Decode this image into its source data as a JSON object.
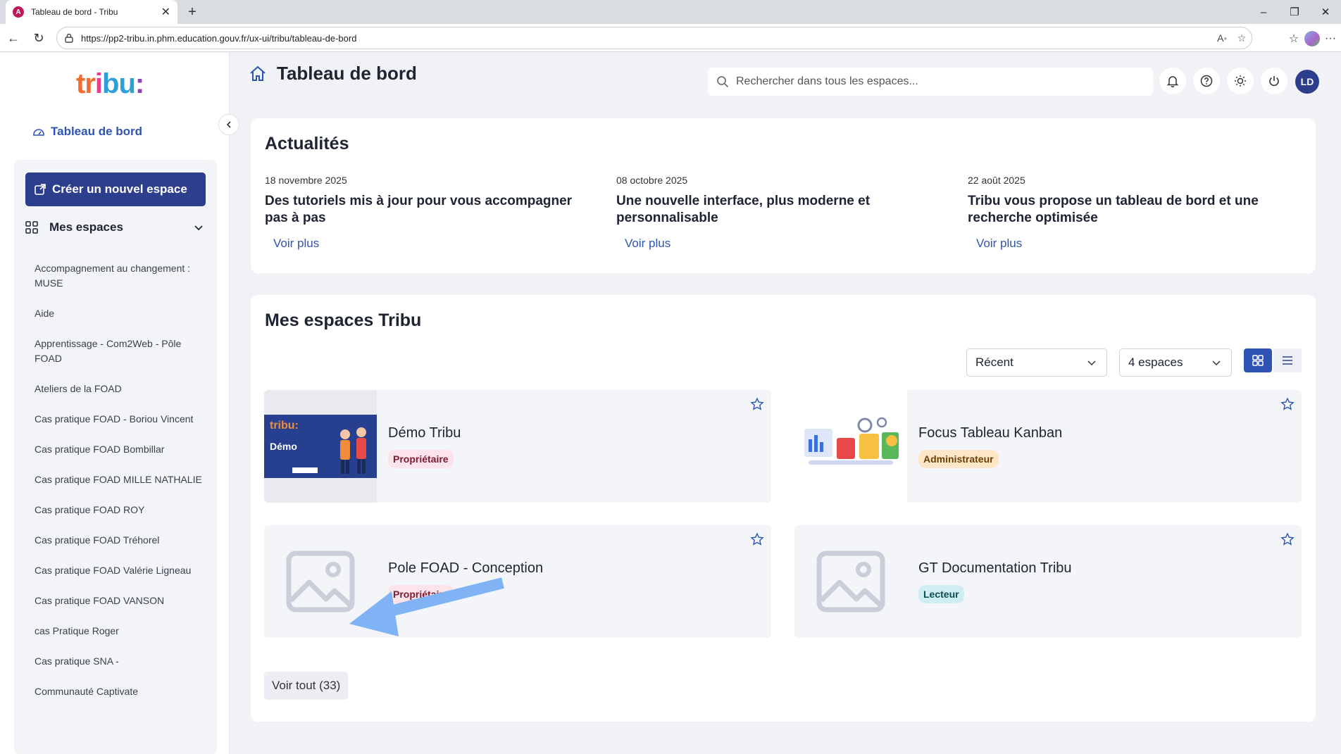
{
  "browser": {
    "tab_title": "Tableau de bord - Tribu",
    "url": "https://pp2-tribu.in.phm.education.gouv.fr/ux-ui/tribu/tableau-de-bord"
  },
  "sidebar": {
    "logo": {
      "t": "tr",
      "i": "i",
      "b": "bu",
      "colon": ":"
    },
    "dashboard_label": "Tableau de bord",
    "create_label": "Créer un nouvel espace",
    "mes_espaces_label": "Mes espaces",
    "espaces": [
      "Accompagnement au changement : MUSE",
      "Aide",
      "Apprentissage - Com2Web - Pôle FOAD",
      "Ateliers de la FOAD",
      "Cas pratique FOAD - Boriou Vincent",
      "Cas pratique FOAD Bombillar",
      "Cas pratique FOAD MILLE NATHALIE",
      "Cas pratique FOAD ROY",
      "Cas pratique FOAD Tréhorel",
      "Cas pratique FOAD Valérie Ligneau",
      "Cas pratique FOAD VANSON",
      "cas Pratique Roger",
      "Cas pratique SNA -",
      "Communauté Captivate"
    ]
  },
  "header": {
    "title": "Tableau de bord",
    "search_placeholder": "Rechercher dans tous les espaces...",
    "avatar_initials": "LD"
  },
  "news": {
    "title": "Actualités",
    "items": [
      {
        "date": "18 novembre 2025",
        "title": "Des tutoriels mis à jour pour vous accompagner pas à pas",
        "more": "Voir plus"
      },
      {
        "date": "08 octobre 2025",
        "title": "Une nouvelle interface, plus moderne et personnalisable",
        "more": "Voir plus"
      },
      {
        "date": "22 août 2025",
        "title": "Tribu vous propose un tableau de bord et une recherche optimisée",
        "more": "Voir plus"
      }
    ]
  },
  "espaces": {
    "title": "Mes espaces Tribu",
    "sort_value": "Récent",
    "count_value": "4 espaces",
    "cards": [
      {
        "name": "Démo Tribu",
        "role": "Propriétaire",
        "thumb_text": "Démo",
        "thumb_logo": "tribu:"
      },
      {
        "name": "Focus Tableau Kanban",
        "role": "Administrateur"
      },
      {
        "name": "Pole FOAD - Conception",
        "role": "Propriétaire"
      },
      {
        "name": "GT Documentation Tribu",
        "role": "Lecteur"
      }
    ],
    "see_all": "Voir tout (33)"
  },
  "colors": {
    "primary": "#2c3e8c",
    "link": "#2e54b3",
    "background": "#f1f2f6",
    "arrow": "#7fb3f5"
  }
}
